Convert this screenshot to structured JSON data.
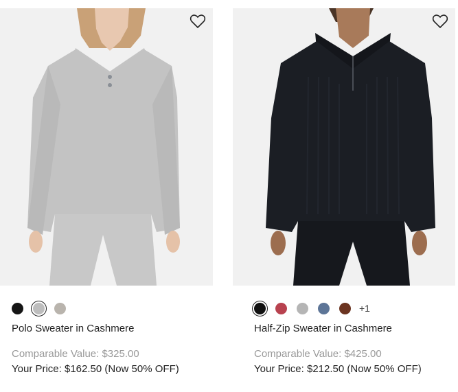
{
  "products": [
    {
      "name": "Polo Sweater in Cashmere",
      "comparable_value": "Comparable Value: $325.00",
      "your_price": "Your Price: $162.50 (Now 50% OFF)",
      "swatches": [
        {
          "color": "#151515",
          "selected": false
        },
        {
          "color": "#bdbdbd",
          "selected": true
        },
        {
          "color": "#b9b4ad",
          "selected": false
        }
      ],
      "more_colors": ""
    },
    {
      "name": "Half-Zip Sweater in Cashmere",
      "comparable_value": "Comparable Value: $425.00",
      "your_price": "Your Price: $212.50 (Now 50% OFF)",
      "swatches": [
        {
          "color": "#111111",
          "selected": true
        },
        {
          "color": "#b8424f",
          "selected": false
        },
        {
          "color": "#b5b5b5",
          "selected": false
        },
        {
          "color": "#5d7597",
          "selected": false
        },
        {
          "color": "#6b3420",
          "selected": false
        }
      ],
      "more_colors": "+1"
    }
  ]
}
